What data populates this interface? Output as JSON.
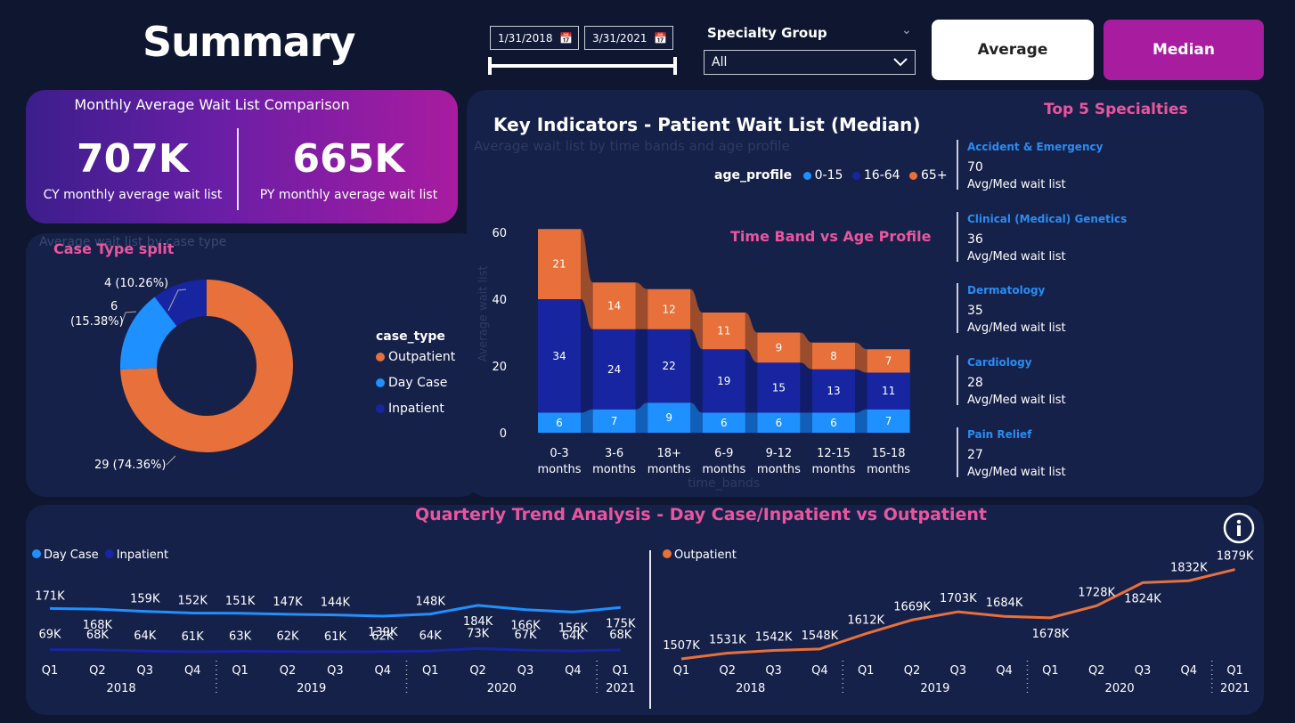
{
  "header": {
    "title": "Summary",
    "date_start": "1/31/2018",
    "date_end": "3/31/2021",
    "specialty_label": "Specialty Group",
    "specialty_value": "All",
    "avg_button": "Average",
    "median_button": "Median"
  },
  "comparison": {
    "title": "Monthly Average Wait List Comparison",
    "cy_value": "707K",
    "cy_label": "CY monthly average wait list",
    "py_value": "665K",
    "py_label": "PY monthly average wait list"
  },
  "case_split": {
    "title": "Case Type split",
    "ghost_title": "Average wait list by case type",
    "legend_title": "case_type",
    "labels": {
      "outpatient": "29 (74.36%)",
      "daycase_a": "6",
      "daycase_b": "(15.38%)",
      "inpatient": "4 (10.26%)"
    },
    "colors": {
      "outpatient": "#e8703a",
      "daycase": "#1e90ff",
      "inpatient": "#1726a0"
    }
  },
  "key_indicators": {
    "title": "Key Indicators - Patient Wait List (Median)",
    "ghost_subtitle": "Average wait list by time bands and age profile",
    "legend_title": "age_profile",
    "subchart_title": "Time Band vs Age Profile",
    "ghost_xlabel": "time_bands",
    "ghost_ylabel": "Average wait list"
  },
  "top5": {
    "title": "Top 5 Specialties",
    "sublabel": "Avg/Med wait list",
    "items": [
      {
        "name": "Accident & Emergency",
        "value": "70"
      },
      {
        "name": "Clinical (Medical) Genetics",
        "value": "36"
      },
      {
        "name": "Dermatology",
        "value": "35"
      },
      {
        "name": "Cardiology",
        "value": "28"
      },
      {
        "name": "Pain Relief",
        "value": "27"
      }
    ]
  },
  "trend": {
    "title": "Quarterly Trend Analysis - Day Case/Inpatient vs Outpatient",
    "info_icon": "info-icon"
  },
  "chart_data": [
    {
      "type": "pie",
      "donut": true,
      "categories": [
        "Outpatient",
        "Day Case",
        "Inpatient"
      ],
      "values": [
        29,
        6,
        4
      ],
      "legend": "right"
    },
    {
      "type": "bar",
      "stacked": true,
      "ribbon": true,
      "categories": [
        "0-3 months",
        "3-6 months",
        "18+ months",
        "6-9 months",
        "9-12 months",
        "12-15 months",
        "15-18 months"
      ],
      "series": [
        {
          "name": "0-15",
          "color": "#1e90ff",
          "values": [
            6,
            7,
            9,
            6,
            6,
            6,
            7
          ]
        },
        {
          "name": "16-64",
          "color": "#1726a0",
          "values": [
            34,
            24,
            22,
            19,
            15,
            13,
            11
          ]
        },
        {
          "name": "65+",
          "color": "#e8703a",
          "values": [
            21,
            14,
            12,
            11,
            9,
            8,
            7
          ]
        }
      ],
      "yticks": [
        0,
        20,
        40,
        60
      ],
      "ylim": [
        0,
        62
      ],
      "legend": "top-right"
    },
    {
      "type": "line",
      "x": [
        "Q1",
        "Q2",
        "Q3",
        "Q4",
        "Q1",
        "Q2",
        "Q3",
        "Q4",
        "Q1",
        "Q2",
        "Q3",
        "Q4",
        "Q1"
      ],
      "years": [
        {
          "label": "2018",
          "span": 4
        },
        {
          "label": "2019",
          "span": 4
        },
        {
          "label": "2020",
          "span": 4
        },
        {
          "label": "2021",
          "span": 1
        }
      ],
      "series": [
        {
          "name": "Day Case",
          "color": "#1e90ff",
          "values": [
            171,
            168,
            159,
            152,
            151,
            147,
            144,
            139,
            148,
            184,
            166,
            156,
            175
          ],
          "labels": [
            "171K",
            "168K",
            "159K",
            "152K",
            "151K",
            "147K",
            "144K",
            "139K",
            "148K",
            "184K",
            "166K",
            "156K",
            "175K"
          ]
        },
        {
          "name": "Inpatient",
          "color": "#1726a0",
          "values": [
            69,
            68,
            64,
            61,
            63,
            62,
            61,
            62,
            64,
            73,
            67,
            64,
            68
          ],
          "labels": [
            "69K",
            "68K",
            "64K",
            "61K",
            "63K",
            "62K",
            "61K",
            "62K",
            "64K",
            "73K",
            "67K",
            "64K",
            "68K"
          ]
        }
      ],
      "legend": "top-left"
    },
    {
      "type": "line",
      "x": [
        "Q1",
        "Q2",
        "Q3",
        "Q4",
        "Q1",
        "Q2",
        "Q3",
        "Q4",
        "Q1",
        "Q2",
        "Q3",
        "Q4",
        "Q1"
      ],
      "years": [
        {
          "label": "2018",
          "span": 4
        },
        {
          "label": "2019",
          "span": 4
        },
        {
          "label": "2020",
          "span": 4
        },
        {
          "label": "2021",
          "span": 1
        }
      ],
      "series": [
        {
          "name": "Outpatient",
          "color": "#e8703a",
          "values": [
            1507,
            1531,
            1542,
            1548,
            1612,
            1669,
            1703,
            1684,
            1678,
            1728,
            1824,
            1832,
            1879
          ],
          "labels": [
            "1507K",
            "1531K",
            "1542K",
            "1548K",
            "1612K",
            "1669K",
            "1703K",
            "1684K",
            "1678K",
            "1728K",
            "1824K",
            "1832K",
            "1879K"
          ]
        }
      ],
      "legend": "top-left"
    }
  ]
}
